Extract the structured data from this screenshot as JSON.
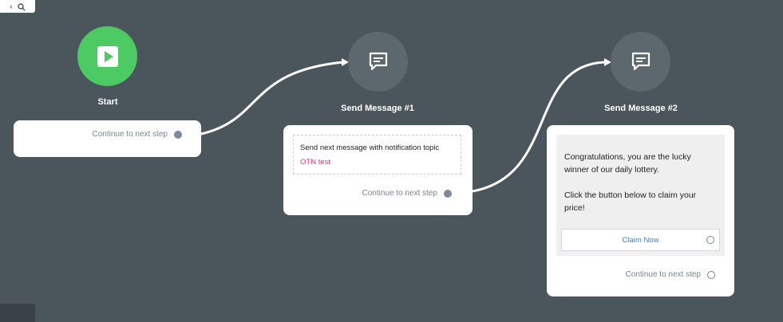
{
  "toolbar": {
    "zoom_icon": "magnifier-icon"
  },
  "start_node": {
    "title": "Start",
    "icon": "play-icon",
    "continue_label": "Continue to next step"
  },
  "message1": {
    "title": "Send Message #1",
    "icon": "chat-bubble-icon",
    "text": "Send next message with notification topic",
    "topic": "OTN test",
    "continue_label": "Continue to next step"
  },
  "message2": {
    "title": "Send Message #2",
    "icon": "chat-bubble-icon",
    "paragraph1": "Congratulations, you are the lucky winner of our daily lottery.",
    "paragraph2": "Click the button below to claim your price!",
    "button_label": "Claim Now",
    "continue_label": "Continue to next step"
  },
  "colors": {
    "canvas": "#4b555c",
    "start_green": "#4dcb63",
    "node_grey": "#5d676e",
    "topic_pink": "#e0357a",
    "button_blue": "#2e86d6"
  }
}
